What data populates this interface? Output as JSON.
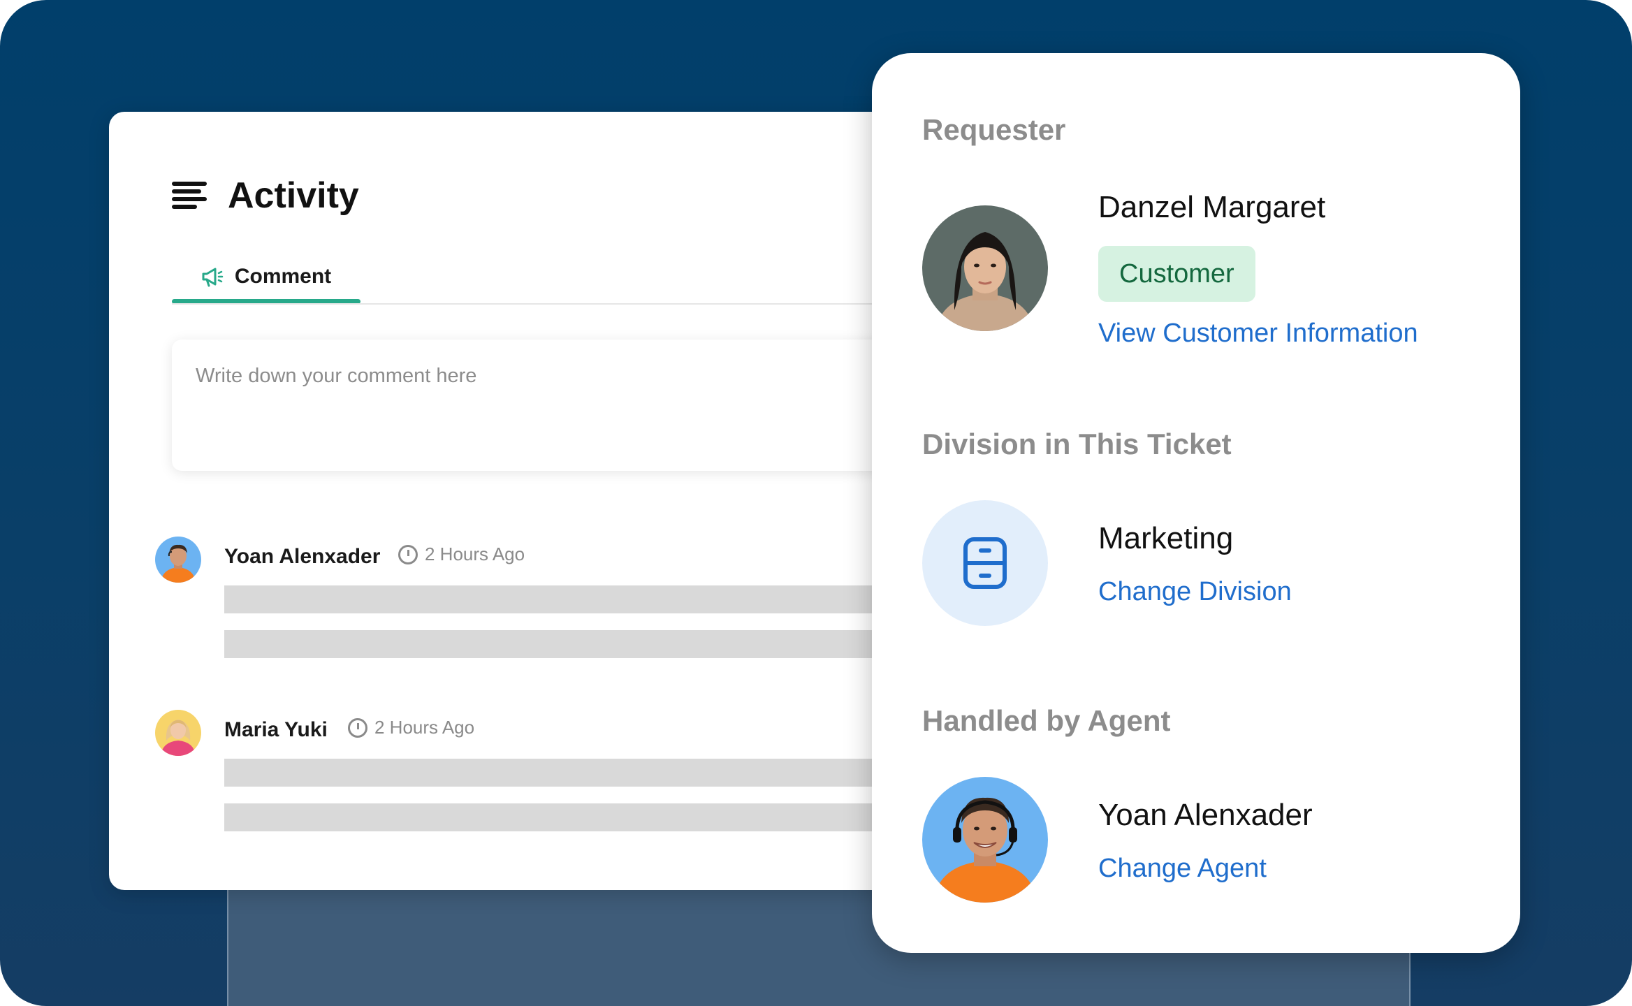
{
  "activity": {
    "title": "Activity",
    "tab_label": "Comment",
    "comment_placeholder": "Write down your comment here",
    "entries": [
      {
        "name": "Yoan Alenxader",
        "time": "2 Hours Ago"
      },
      {
        "name": "Maria Yuki",
        "time": "2 Hours Ago"
      }
    ]
  },
  "requester": {
    "section_label": "Requester",
    "name": "Danzel Margaret",
    "role_badge": "Customer",
    "link": "View Customer Information"
  },
  "division": {
    "section_label": "Division in This Ticket",
    "name": "Marketing",
    "link": "Change Division"
  },
  "agent": {
    "section_label": "Handled by Agent",
    "name": "Yoan Alenxader",
    "link": "Change Agent"
  },
  "colors": {
    "background": "#013f6b",
    "tab_accent": "#27a98a",
    "link": "#1f6dcc",
    "badge_bg": "#d6f2e1",
    "badge_text": "#14683e"
  },
  "icons": [
    "menu-lines-icon",
    "megaphone-icon",
    "clock-icon",
    "cabinet-icon"
  ]
}
